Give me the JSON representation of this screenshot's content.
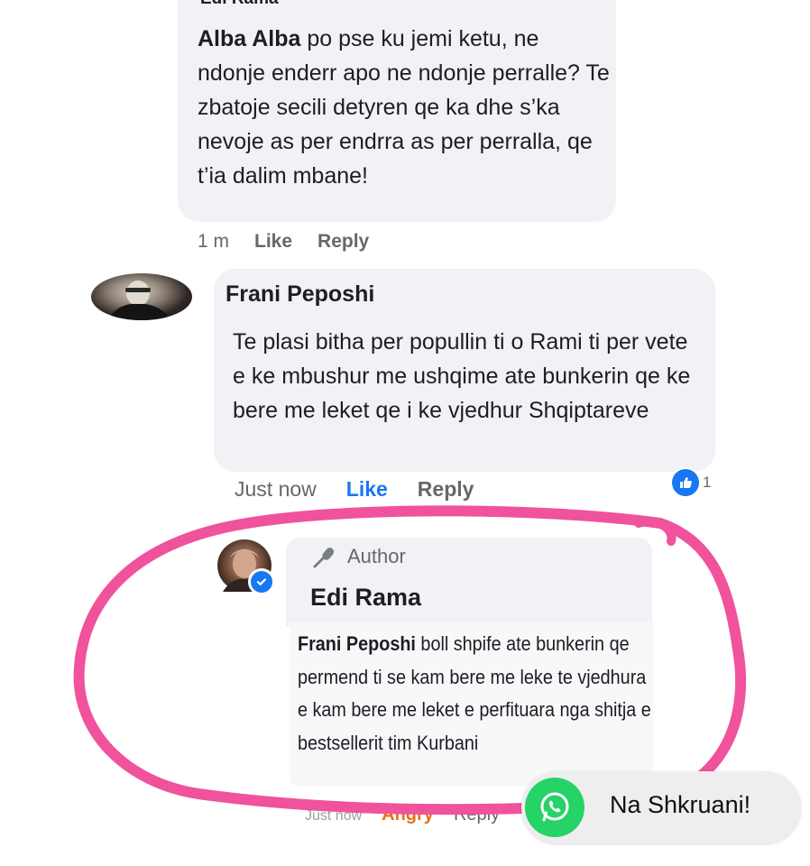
{
  "comment_1": {
    "author": "Edi Rama",
    "mention": "Alba Alba",
    "text": " po pse ku jemi ketu, ne ndonje enderr apo ne ndonje perralle? Te zbatoje secili detyren qe ka dhe s’ka nevoje as per endrra as per perralla, qe t’ia dalim mbane!",
    "time": "1 m",
    "like_label": "Like",
    "reply_label": "Reply"
  },
  "comment_2": {
    "author": "Frani Peposhi",
    "text": "Te plasi bitha per popullin ti o Rami ti per vete e ke mbushur me ushqime ate bunkerin qe ke bere me leket qe i ke vjedhur Shqiptareve",
    "time": "Just now",
    "like_label": "Like",
    "reply_label": "Reply",
    "reaction_count": "1",
    "reaction_icon": "thumbs-up-icon"
  },
  "comment_3": {
    "badge": "Author",
    "author": "Edi Rama",
    "mention": "Frani Peposhi",
    "text": " boll shpife ate bunkerin qe permend ti se kam bere me leke te vjedhura e kam bere me leket e perfituara nga shitja e bestsellerit tim Kurbani",
    "time": "Just now",
    "angry_label": "Angry",
    "reply_label": "Reply",
    "verified_icon": "verified-check-icon"
  },
  "whatsapp": {
    "label": "Na Shkruani!",
    "icon": "whatsapp-icon",
    "color": "#25d366"
  },
  "colors": {
    "highlight": "#f0529c",
    "link_blue": "#1877f2",
    "bubble": "#f0f2f5",
    "angry": "#e9710f"
  }
}
